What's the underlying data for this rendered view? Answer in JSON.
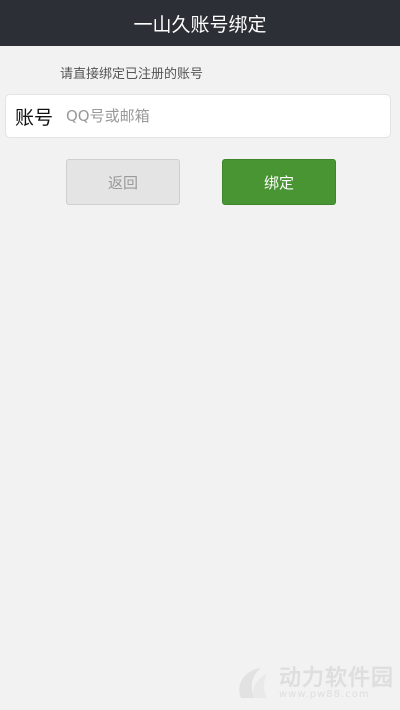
{
  "header": {
    "title": "一山久账号绑定"
  },
  "hint": "请直接绑定已注册的账号",
  "account": {
    "label": "账号",
    "placeholder": "QQ号或邮箱",
    "value": ""
  },
  "buttons": {
    "back_label": "返回",
    "bind_label": "绑定"
  },
  "colors": {
    "titlebar": "#2c2f36",
    "bind_button": "#4a9533",
    "back_button": "#e4e4e4"
  },
  "watermark": {
    "title": "动力软件园",
    "url": "www.pw88.com"
  }
}
